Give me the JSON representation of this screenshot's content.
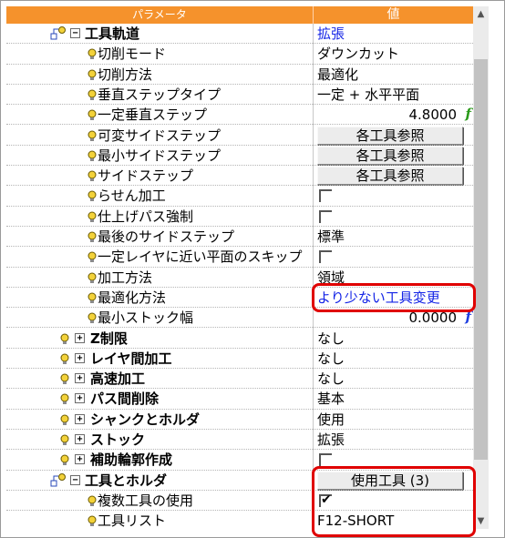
{
  "header": {
    "param_label": "パラメータ",
    "value_label": "値"
  },
  "rows": [
    {
      "name": "工具軌道",
      "value": "拡張",
      "level": 0,
      "type": "section",
      "expanded": true,
      "value_style": "blue"
    },
    {
      "name": "切削モード",
      "value": "ダウンカット",
      "level": 1,
      "type": "text"
    },
    {
      "name": "切削方法",
      "value": "最適化",
      "level": 1,
      "type": "text"
    },
    {
      "name": "垂直ステップタイプ",
      "value": "一定 + 水平平面",
      "level": 1,
      "type": "text"
    },
    {
      "name": "一定垂直ステップ",
      "value": "4.8000",
      "level": 1,
      "type": "number",
      "fn": "green"
    },
    {
      "name": "可変サイドステップ",
      "value": "各工具参照",
      "level": 1,
      "type": "button"
    },
    {
      "name": "最小サイドステップ",
      "value": "各工具参照",
      "level": 1,
      "type": "button"
    },
    {
      "name": "サイドステップ",
      "value": "各工具参照",
      "level": 1,
      "type": "button"
    },
    {
      "name": "らせん加工",
      "value": "",
      "level": 1,
      "type": "checkbox",
      "checked": false
    },
    {
      "name": "仕上げパス強制",
      "value": "",
      "level": 1,
      "type": "checkbox",
      "checked": false
    },
    {
      "name": "最後のサイドステップ",
      "value": "標準",
      "level": 1,
      "type": "text"
    },
    {
      "name": "一定レイヤに近い平面のスキップ",
      "value": "",
      "level": 1,
      "type": "checkbox",
      "checked": false
    },
    {
      "name": "加工方法",
      "value": "領域",
      "level": 1,
      "type": "text"
    },
    {
      "name": "最適化方法",
      "value": "より少ない工具変更",
      "level": 1,
      "type": "text",
      "value_style": "blue"
    },
    {
      "name": "最小ストック幅",
      "value": "0.0000",
      "level": 1,
      "type": "number",
      "fn": "blue"
    },
    {
      "name": "Z制限",
      "value": "なし",
      "level": 0.5,
      "type": "group"
    },
    {
      "name": "レイヤ間加工",
      "value": "なし",
      "level": 0.5,
      "type": "group"
    },
    {
      "name": "高速加工",
      "value": "なし",
      "level": 0.5,
      "type": "group"
    },
    {
      "name": "パス間削除",
      "value": "基本",
      "level": 0.5,
      "type": "group"
    },
    {
      "name": "シャンクとホルダ",
      "value": "使用",
      "level": 0.5,
      "type": "group"
    },
    {
      "name": "ストック",
      "value": "拡張",
      "level": 0.5,
      "type": "group"
    },
    {
      "name": "補助輪郭作成",
      "value": "",
      "level": 0.5,
      "type": "group-checkbox",
      "checked": false
    },
    {
      "name": "工具とホルダ",
      "value": "使用工具 (3)",
      "level": 0,
      "type": "section-button",
      "expanded": true
    },
    {
      "name": "複数工具の使用",
      "value": "",
      "level": 1,
      "type": "checkbox",
      "checked": true
    },
    {
      "name": "工具リスト",
      "value": "F12-SHORT",
      "level": 1,
      "type": "text"
    }
  ],
  "colors": {
    "header_orange": "#f5922c",
    "link_blue": "#1424e6",
    "highlight_red": "#e00000",
    "fn_green": "#2a9a1a"
  },
  "icons": {
    "expand": "minus-box-icon",
    "collapse": "plus-box-icon",
    "bulb": "lightbulb-icon",
    "tree": "tree-node-icon"
  }
}
